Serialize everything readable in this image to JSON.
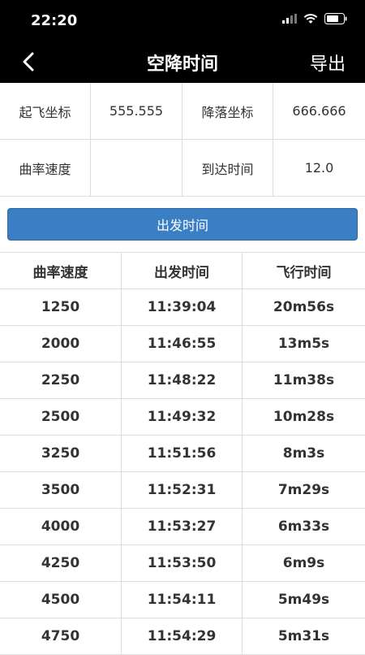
{
  "status": {
    "time": "22:20"
  },
  "nav": {
    "title": "空降时间",
    "export_label": "导出"
  },
  "info": {
    "takeoff_label": "起飞坐标",
    "takeoff_value": "555.555",
    "landing_label": "降落坐标",
    "landing_value": "666.666",
    "curve_label": "曲率速度",
    "curve_value": "",
    "arrival_label": "到达时间",
    "arrival_value": "12.0"
  },
  "button": {
    "depart_label": "出发时间"
  },
  "table": {
    "headers": [
      "曲率速度",
      "出发时间",
      "飞行时间"
    ],
    "rows": [
      [
        "1250",
        "11:39:04",
        "20m56s"
      ],
      [
        "2000",
        "11:46:55",
        "13m5s"
      ],
      [
        "2250",
        "11:48:22",
        "11m38s"
      ],
      [
        "2500",
        "11:49:32",
        "10m28s"
      ],
      [
        "3250",
        "11:51:56",
        "8m3s"
      ],
      [
        "3500",
        "11:52:31",
        "7m29s"
      ],
      [
        "4000",
        "11:53:27",
        "6m33s"
      ],
      [
        "4250",
        "11:53:50",
        "6m9s"
      ],
      [
        "4500",
        "11:54:11",
        "5m49s"
      ],
      [
        "4750",
        "11:54:29",
        "5m31s"
      ]
    ]
  }
}
